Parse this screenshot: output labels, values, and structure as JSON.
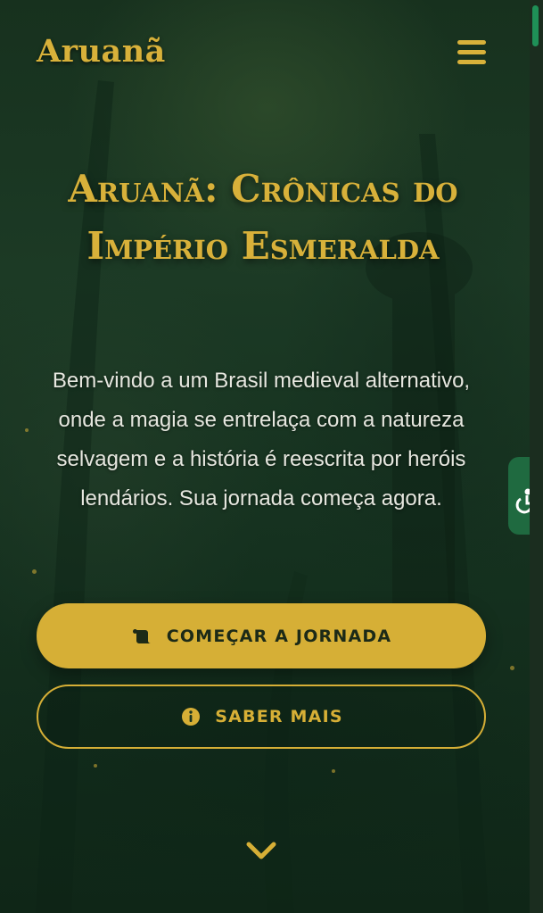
{
  "header": {
    "logo_text": "Aruanã",
    "menu_icon": "hamburger-menu-icon"
  },
  "hero": {
    "title": "Aruanã: Crônicas do Império Esmeralda",
    "description": "Bem-vindo a um Brasil medieval alternativo, onde a magia se entrelaça com a natureza selvagem e a história é reescrita por heróis lendários. Sua jornada começa agora.",
    "primary_button": {
      "label": "COMEÇAR A JORNADA",
      "icon": "scroll-icon"
    },
    "secondary_button": {
      "label": "SABER MAIS",
      "icon": "info-circle-icon"
    },
    "scroll_indicator_icon": "chevron-down-icon"
  },
  "side_tab": {
    "icon": "accessibility-icon"
  },
  "colors": {
    "background": "#1a3522",
    "accent_gold": "#d6af36",
    "text_light": "#e6e7df",
    "side_tab_green": "#1f6a40",
    "scrollbar_thumb": "#1f8f57"
  }
}
